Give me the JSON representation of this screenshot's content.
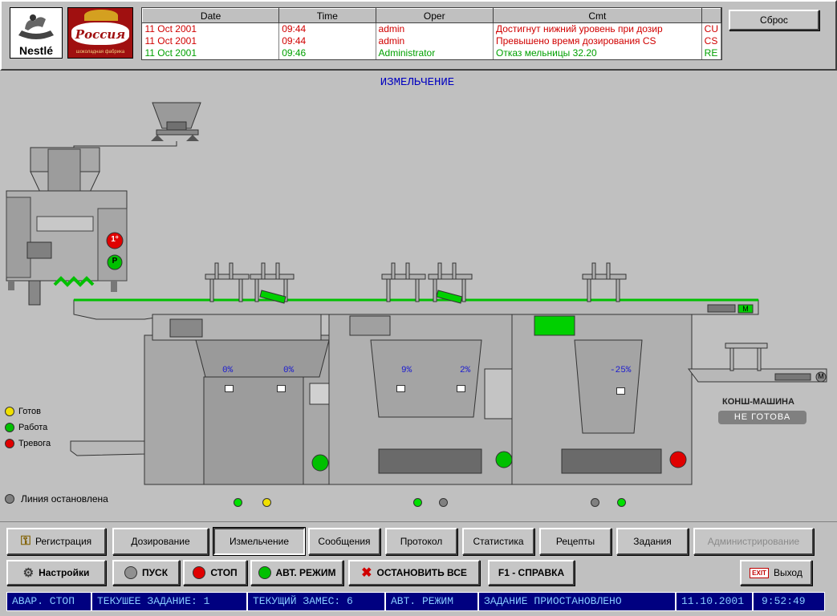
{
  "header": {
    "logos": [
      {
        "name": "nestle-logo",
        "text": "Nestlé"
      },
      {
        "name": "rossiya-logo",
        "text": "Россия",
        "subtext": "шоколадная фабрика"
      }
    ],
    "reset_button": "Сброс"
  },
  "alarms": {
    "columns": [
      "Date",
      "Time",
      "Oper",
      "Cmt",
      ""
    ],
    "rows": [
      {
        "date": "11 Oct 2001",
        "time": "09:44",
        "oper": "admin",
        "cmt": "Достигнут нижний уровень при дозир",
        "extra": "CU",
        "color": "red"
      },
      {
        "date": "11 Oct 2001",
        "time": "09:44",
        "oper": "admin",
        "cmt": "Превышено время дозирования CS",
        "extra": "CS",
        "color": "red"
      },
      {
        "date": "11 Oct 2001",
        "time": "09:46",
        "oper": "Administrator",
        "cmt": "Отказ мельницы 32.20",
        "extra": "RE",
        "color": "green"
      }
    ]
  },
  "process": {
    "title": "ИЗМЕЛЬЧЕНИЕ",
    "mixer_labels": {
      "l1": "1°",
      "l2": "P"
    },
    "conveyor_motor": "M",
    "conche_motor": "M",
    "mills": [
      {
        "left_pct": "0%",
        "right_pct": "0%"
      },
      {
        "left_pct": "9%",
        "right_pct": "2%"
      },
      {
        "left_pct": "",
        "right_pct": "-25%"
      }
    ],
    "conche": {
      "label": "КОНШ-МАШИНА",
      "status": "НЕ ГОТОВА"
    },
    "legend": [
      {
        "label": "Готов",
        "color": "#f0e000"
      },
      {
        "label": "Работа",
        "color": "#00c000"
      },
      {
        "label": "Тревога",
        "color": "#e00000"
      }
    ],
    "line_status": "Линия остановлена",
    "colors": {
      "green": "#00e000",
      "yellow": "#f0e000",
      "red": "#e00000",
      "gray": "#808080"
    }
  },
  "nav": {
    "row1": [
      "Регистрация",
      "Дозирование",
      "Измельчение",
      "Сообщения",
      "Протокол",
      "Статистика",
      "Рецепты",
      "Задания",
      "Администрирование"
    ],
    "row2": {
      "settings": "Настройки",
      "start": "ПУСК",
      "stop": "СТОП",
      "auto": "АВТ. РЕЖИМ",
      "stop_all": "ОСТАНОВИТЬ ВСЕ",
      "help": "F1 - СПРАВКА",
      "exit_icon": "EXIT",
      "exit": "Выход"
    }
  },
  "status_bar": {
    "emergency": "АВАР. СТОП",
    "current_task": "ТЕКУШЕЕ ЗАДАНИЕ: 1",
    "current_batch": "ТЕКУЩИЙ ЗАМЕС: 6",
    "mode": "АВТ. РЕЖИМ",
    "task_state": "ЗАДАНИЕ ПРИОСТАНОВЛЕНО",
    "date": "11.10.2001",
    "time": "9:52:49"
  }
}
